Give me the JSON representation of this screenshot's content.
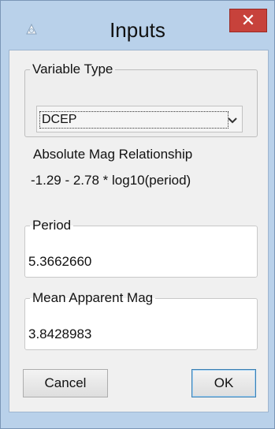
{
  "window": {
    "title": "Inputs",
    "close_label": "✕"
  },
  "variable_type": {
    "legend": "Variable Type",
    "selected": "DCEP"
  },
  "absolute_mag": {
    "label": "Absolute Mag Relationship",
    "formula": "-1.29 - 2.78 * log10(period)"
  },
  "period": {
    "legend": "Period",
    "value": "5.3662660"
  },
  "mean_apparent_mag": {
    "legend": "Mean Apparent Mag",
    "value": "3.8428983"
  },
  "buttons": {
    "cancel": "Cancel",
    "ok": "OK"
  },
  "colors": {
    "frame": "#b9d1ea",
    "close_button": "#c7423b"
  }
}
